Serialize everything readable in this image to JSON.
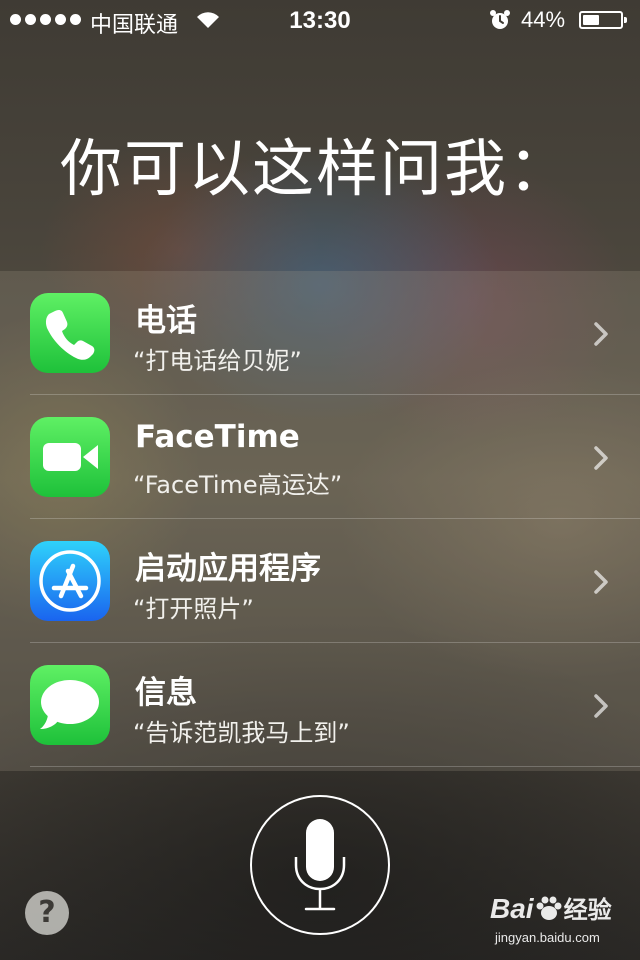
{
  "status_bar": {
    "carrier": "中国联通",
    "time": "13:30",
    "battery_percent_label": "44%",
    "battery_level": 0.44,
    "signal_bars": 5,
    "icons": [
      "signal-dots-icon",
      "wifi-icon",
      "alarm-icon",
      "battery-icon"
    ]
  },
  "heading": "你可以这样问我：",
  "suggestions": [
    {
      "title": "电话",
      "example": "“打电话给贝妮”",
      "icon": "phone-icon",
      "icon_color": "#2ac845"
    },
    {
      "title": "FaceTime",
      "example": "“FaceTime高运达”",
      "icon": "facetime-icon",
      "icon_color": "#2ac845"
    },
    {
      "title": "启动应用程序",
      "example": "“打开照片”",
      "icon": "app-store-icon",
      "icon_color": "#1a8cf5"
    },
    {
      "title": "信息",
      "example": "“告诉范凯我马上到”",
      "icon": "messages-icon",
      "icon_color": "#2ac845"
    }
  ],
  "help_label": "?",
  "mic": {
    "icon": "microphone-icon"
  },
  "watermark": {
    "logo_text": "Bai",
    "logo_suffix": "经验",
    "url": "jingyan.baidu.com"
  }
}
